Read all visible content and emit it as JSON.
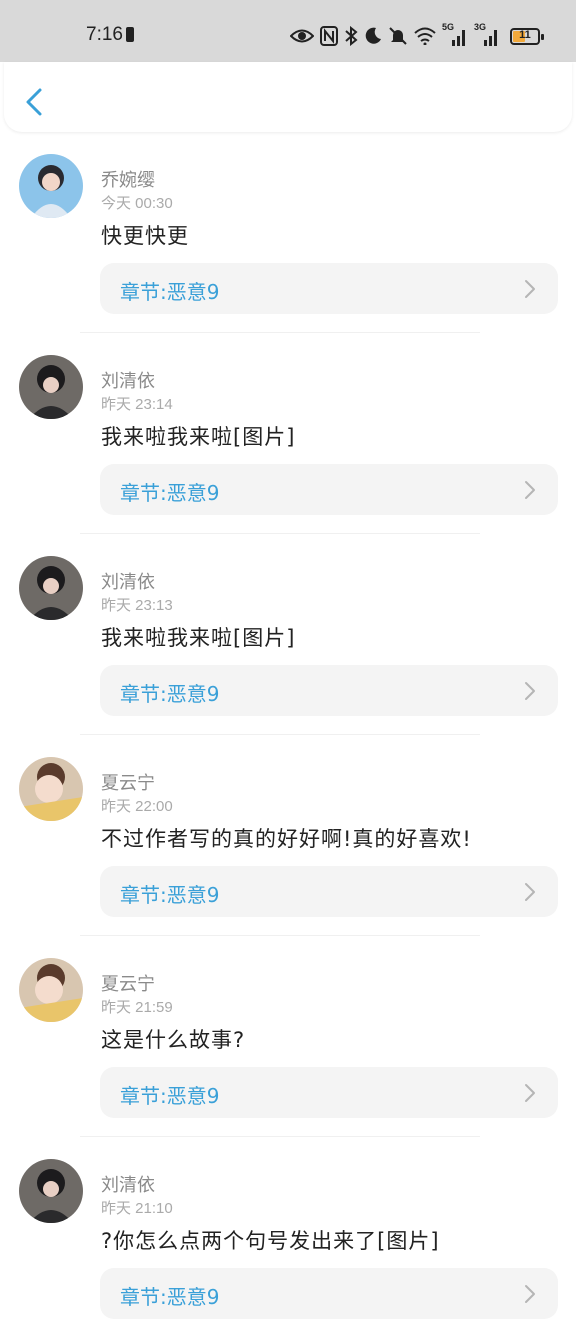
{
  "status_bar": {
    "time": "7:16",
    "net1_label": "5G",
    "net2_label": "3G",
    "battery": "11"
  },
  "comments": [
    {
      "user": "乔婉缨",
      "time": "今天  00:30",
      "text": "快更快更",
      "chapter": "章节:恶意9"
    },
    {
      "user": "刘清依",
      "time": "昨天  23:14",
      "text": "我来啦我来啦[图片]",
      "chapter": "章节:恶意9"
    },
    {
      "user": "刘清依",
      "time": "昨天  23:13",
      "text": "我来啦我来啦[图片]",
      "chapter": "章节:恶意9"
    },
    {
      "user": "夏云宁",
      "time": "昨天  22:00",
      "text": "不过作者写的真的好好啊!真的好喜欢!",
      "chapter": "章节:恶意9"
    },
    {
      "user": "夏云宁",
      "time": "昨天  21:59",
      "text": "这是什么故事?",
      "chapter": "章节:恶意9"
    },
    {
      "user": "刘清依",
      "time": "昨天  21:10",
      "text": "?你怎么点两个句号发出来了[图片]",
      "chapter": "章节:恶意9"
    }
  ],
  "colors": {
    "accent": "#3aa0d8",
    "status_bar_bg": "#d9d9d9",
    "chapter_bg": "#f4f4f4",
    "battery_fill": "#f2a93b"
  },
  "icons": {
    "back": "chevron-left-icon",
    "chapter_arrow": "chevron-right-icon"
  }
}
